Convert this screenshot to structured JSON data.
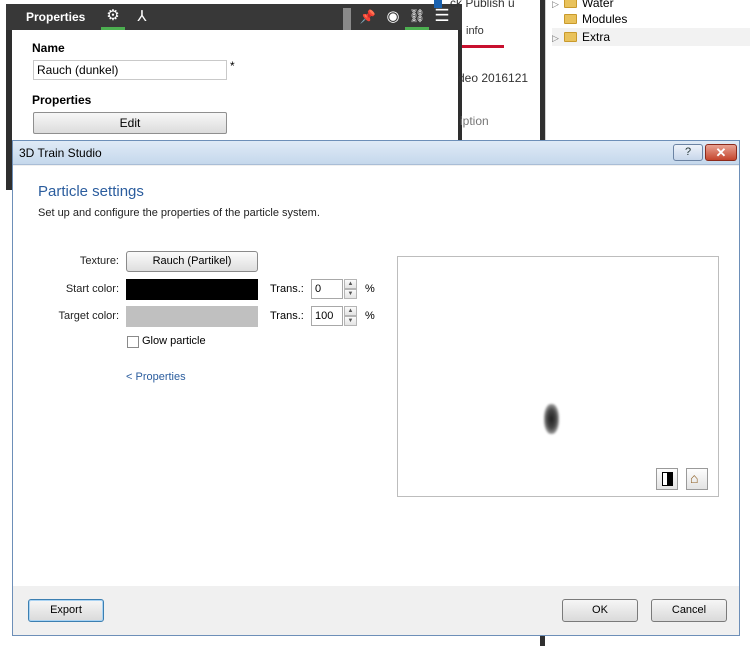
{
  "props_panel": {
    "title": "Properties",
    "name_label": "Name",
    "name_value": "Rauch (dunkel)",
    "name_required_mark": "*",
    "properties_label": "Properties",
    "edit_label": "Edit",
    "icons": [
      "gear-icon",
      "axes-icon",
      "pin-icon",
      "eye-icon",
      "link-icon",
      "menu-icon"
    ]
  },
  "background_fragments": {
    "mid_top": "ck  Publish  u",
    "mid_tab": "info",
    "mid_text1": "deo 2016121",
    "mid_text2": "iption",
    "tab_underline_color": "#c8102e"
  },
  "tree": {
    "items": [
      {
        "label": "Water",
        "expandable": true
      },
      {
        "label": "Modules",
        "expandable": false
      },
      {
        "label": "Extra",
        "expandable": true
      }
    ]
  },
  "dialog": {
    "title": "3D Train Studio",
    "help_label": "?",
    "close_label": "✕",
    "heading": "Particle settings",
    "subtitle": "Set up and configure the properties of the particle system.",
    "texture_label": "Texture:",
    "texture_value": "Rauch (Partikel)",
    "start_color_label": "Start color:",
    "start_color": "#000000",
    "start_trans_label": "Trans.:",
    "start_trans_value": "0",
    "target_color_label": "Target color:",
    "target_color": "#c0c0c0",
    "target_trans_label": "Trans.:",
    "target_trans_value": "100",
    "pct_sign": "%",
    "glow_label": "Glow particle",
    "glow_checked": false,
    "back_link": "< Properties",
    "preview_icons": [
      "background-toggle-icon",
      "home-icon"
    ],
    "export_label": "Export",
    "ok_label": "OK",
    "cancel_label": "Cancel"
  },
  "colors": {
    "accent_heading": "#2b5d9e",
    "titlebar": "#c5d8ec",
    "close_button": "#c4452d",
    "header_dark": "#383838"
  }
}
